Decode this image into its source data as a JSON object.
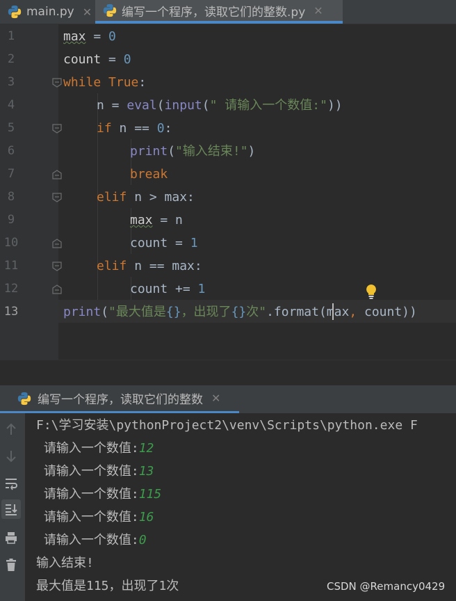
{
  "tabs": [
    {
      "label": "main.py",
      "icon": "python-icon",
      "active": false
    },
    {
      "label": "编写一个程序，读取它们的整数.py",
      "icon": "python-icon",
      "active": true
    }
  ],
  "editor": {
    "line_numbers": [
      "1",
      "2",
      "3",
      "4",
      "5",
      "6",
      "7",
      "8",
      "9",
      "10",
      "11",
      "12",
      "13"
    ],
    "current_line": "13",
    "code": {
      "l1_var": "max",
      "l1_eq": " = ",
      "l1_num": "0",
      "l2_var": "count",
      "l2_eq": " = ",
      "l2_num": "0",
      "l3_kw": "while",
      "l3_sp": " ",
      "l3_true": "True",
      "l3_colon": ":",
      "l4_pre": "n = ",
      "l4_eval": "eval",
      "l4_p1": "(",
      "l4_input": "input",
      "l4_p2": "(",
      "l4_str": "\" 请输入一个数值:\"",
      "l4_p3": "))",
      "l5_kw": "if",
      "l5_rest": " n == ",
      "l5_num": "0",
      "l5_colon": ":",
      "l6_print": "print",
      "l6_p1": "(",
      "l6_str": "\"输入结束!\"",
      "l6_p2": ")",
      "l7_kw": "break",
      "l8_kw": "elif",
      "l8_rest": " n > max:",
      "l9_var": "max",
      "l9_rest": " = n",
      "l10_pre": "count = ",
      "l10_num": "1",
      "l11_kw": "elif",
      "l11_rest": " n == max:",
      "l12_pre": "count += ",
      "l12_num": "1",
      "l13_print": "print",
      "l13_p1": "(",
      "l13_s1": "\"最大值是",
      "l13_b1": "{}",
      "l13_s2": "，出现了",
      "l13_b2": "{}",
      "l13_s3": "次\"",
      "l13_dot": ".format(max",
      "l13_comma": ",",
      "l13_rest": " count))"
    }
  },
  "run": {
    "tab_label": "编写一个程序，读取它们的整数",
    "tools": [
      "up-arrow-icon",
      "down-arrow-icon",
      "soft-wrap-icon",
      "scroll-to-end-icon",
      "print-icon",
      "trash-icon"
    ],
    "command": "F:\\学习安装\\pythonProject2\\venv\\Scripts\\python.exe F",
    "prompts": [
      {
        "prompt": " 请输入一个数值:",
        "value": "12"
      },
      {
        "prompt": " 请输入一个数值:",
        "value": "13"
      },
      {
        "prompt": " 请输入一个数值:",
        "value": "115"
      },
      {
        "prompt": " 请输入一个数值:",
        "value": "16"
      },
      {
        "prompt": " 请输入一个数值:",
        "value": "0"
      }
    ],
    "end_msg": "输入结束!",
    "result": "最大值是115，出现了1次"
  },
  "watermark": "CSDN @Remancy0429",
  "colors": {
    "keyword": "#cc7832",
    "number": "#6897bb",
    "string": "#6a8759",
    "builtin": "#8888c6",
    "input": "#3d9b4c",
    "accent": "#4a88c7"
  }
}
